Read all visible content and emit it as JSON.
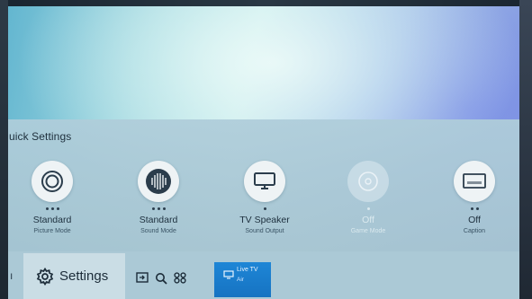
{
  "panel": {
    "title": "uick Settings"
  },
  "quick_settings": [
    {
      "icon": "picture-mode-icon",
      "value": "Standard",
      "label": "Picture Mode",
      "dots": 3,
      "enabled": true
    },
    {
      "icon": "sound-mode-icon",
      "value": "Standard",
      "label": "Sound Mode",
      "dots": 3,
      "enabled": true
    },
    {
      "icon": "tv-speaker-icon",
      "value": "TV Speaker",
      "label": "Sound Output",
      "dots": 1,
      "enabled": true
    },
    {
      "icon": "game-mode-icon",
      "value": "Off",
      "label": "Game Mode",
      "dots": 1,
      "enabled": false
    },
    {
      "icon": "caption-icon",
      "value": "Off",
      "label": "Caption",
      "dots": 2,
      "enabled": true
    }
  ],
  "bottom_bar": {
    "left_stub": "ı",
    "settings_label": "Settings",
    "live_tv": {
      "title": "Live TV",
      "subtitle": "Air"
    }
  },
  "colors": {
    "accent_live_tv": "#1a7fd0",
    "panel": "#a9c7d4",
    "text_dark": "#1d2f3d"
  }
}
